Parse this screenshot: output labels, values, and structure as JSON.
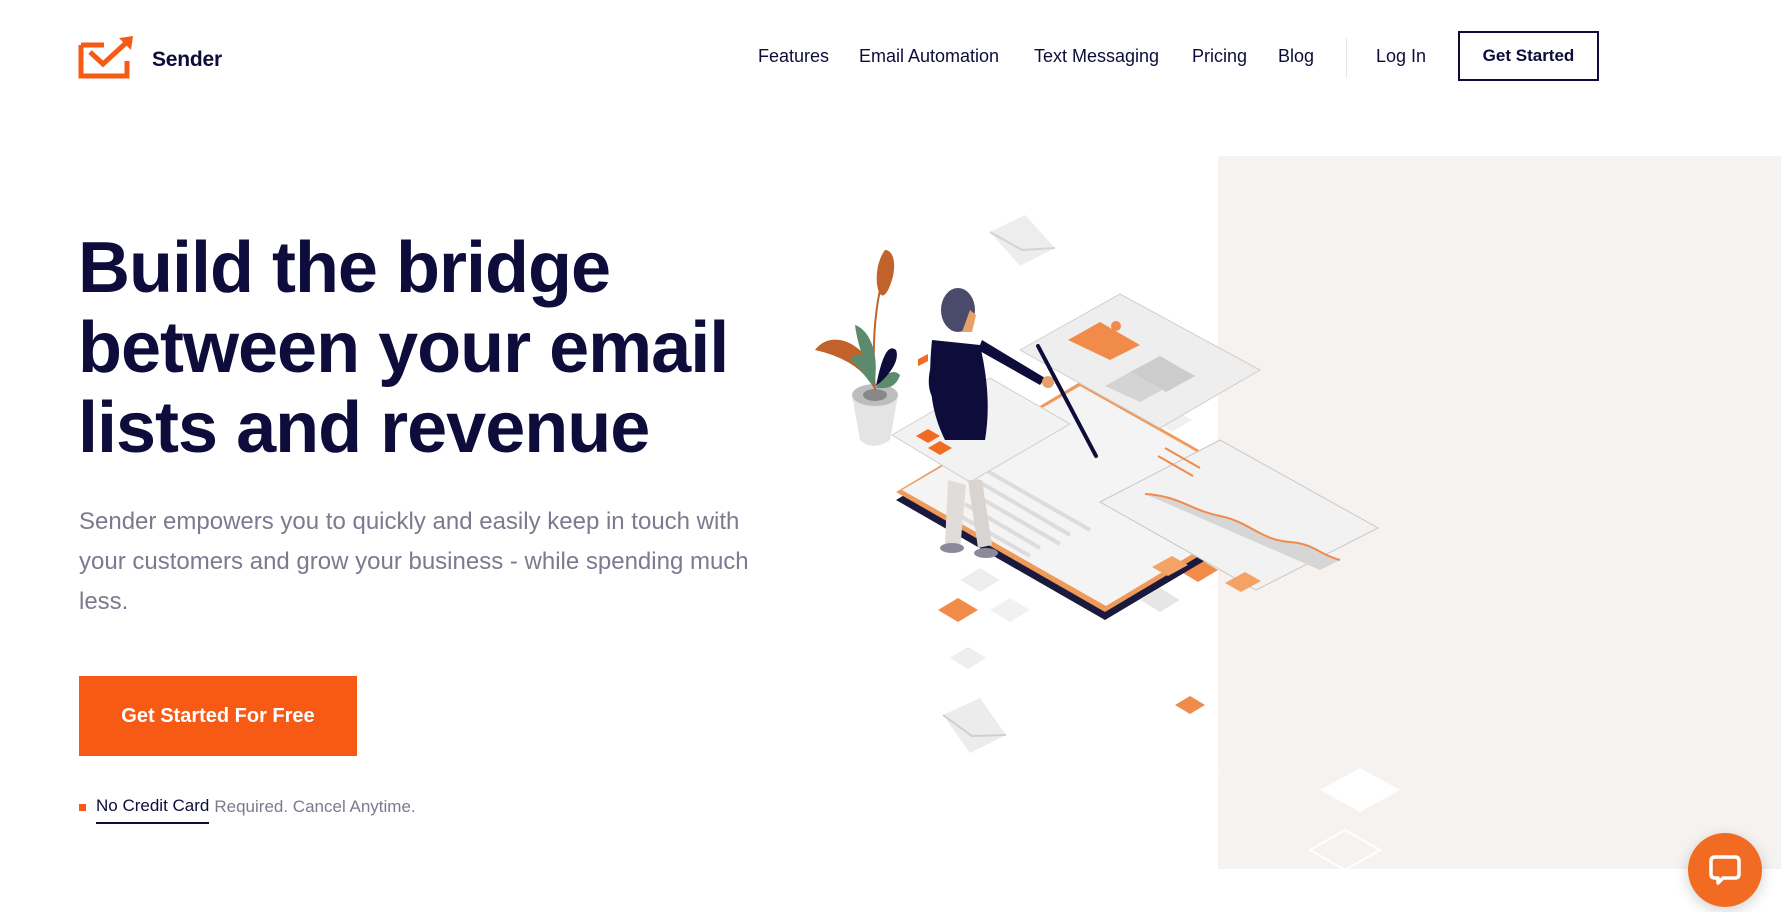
{
  "brand": {
    "name": "Sender",
    "logo_icon": "envelope-arrow-icon",
    "accent_color": "#f75a14",
    "ink_color": "#0d0c3a",
    "muted_color": "#7b7a8f",
    "panel_color": "#f6f2ef"
  },
  "nav": {
    "items": [
      {
        "label": "Features"
      },
      {
        "label": "Email Automation"
      },
      {
        "label": "Text Messaging"
      },
      {
        "label": "Pricing"
      },
      {
        "label": "Blog"
      }
    ],
    "login_label": "Log In",
    "cta_label": "Get Started"
  },
  "hero": {
    "title_lines": [
      "Build the bridge",
      "between your email",
      "lists and revenue"
    ],
    "subtitle": "Sender empowers you to quickly and easily keep in touch with your customers and grow your business - while spending much less.",
    "cta_label": "Get Started For Free",
    "note_strong": "No Credit Card",
    "note_rest": "Required. Cancel Anytime."
  },
  "illustration": {
    "description": "isometric-person-with-pointer-email-dashboard",
    "icons": [
      "plant-icon",
      "person-icon",
      "envelope-icon",
      "chart-panel-icon",
      "image-panel-icon"
    ]
  },
  "chat_widget": {
    "icon": "chat-bubble-icon"
  }
}
